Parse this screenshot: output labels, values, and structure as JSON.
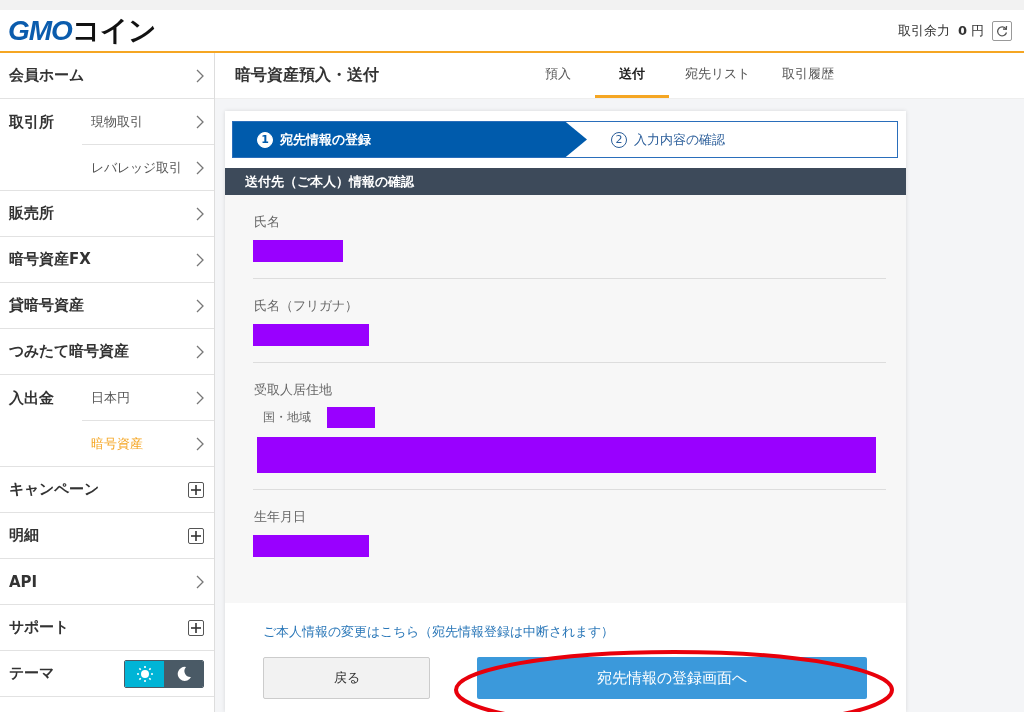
{
  "header": {
    "logo": {
      "brand": "GMO",
      "name": "コイン"
    },
    "balance_label": "取引余力",
    "balance_value": "0",
    "balance_unit": "円"
  },
  "sidebar": {
    "items": [
      {
        "kind": "link",
        "label": "会員ホーム"
      },
      {
        "kind": "group",
        "label": "取引所",
        "children": [
          {
            "label": "現物取引",
            "selected": false
          },
          {
            "label": "レバレッジ取引",
            "selected": false
          }
        ]
      },
      {
        "kind": "link",
        "label": "販売所"
      },
      {
        "kind": "link",
        "label": "暗号資産FX"
      },
      {
        "kind": "link",
        "label": "貸暗号資産"
      },
      {
        "kind": "link",
        "label": "つみたて暗号資産"
      },
      {
        "kind": "group",
        "label": "入出金",
        "children": [
          {
            "label": "日本円",
            "selected": false
          },
          {
            "label": "暗号資産",
            "selected": true
          }
        ]
      },
      {
        "kind": "expand",
        "label": "キャンペーン",
        "expanded": false
      },
      {
        "kind": "expand",
        "label": "明細",
        "expanded": false
      },
      {
        "kind": "link",
        "label": "API"
      },
      {
        "kind": "expand",
        "label": "サポート",
        "expanded": false
      },
      {
        "kind": "theme",
        "label": "テーマ",
        "options": [
          {
            "kind": "sun",
            "selected": true
          },
          {
            "kind": "moon",
            "selected": false
          }
        ]
      }
    ]
  },
  "page": {
    "title": "暗号資産預入・送付",
    "tabs": [
      {
        "label": "預入",
        "selected": false
      },
      {
        "label": "送付",
        "selected": true
      },
      {
        "label": "宛先リスト",
        "selected": false
      },
      {
        "label": "取引履歴",
        "selected": false
      }
    ]
  },
  "steps": [
    {
      "number": "1",
      "label": "宛先情報の登録",
      "selected": true
    },
    {
      "number": "2",
      "label": "入力内容の確認",
      "selected": false
    }
  ],
  "section": {
    "title": "送付先（ご本人）情報の確認",
    "fields": [
      {
        "kind": "simple",
        "label": "氏名"
      },
      {
        "kind": "simple",
        "label": "氏名（フリガナ）"
      },
      {
        "kind": "address",
        "label": "受取人居住地",
        "sub_label": "国・地域"
      },
      {
        "kind": "simple",
        "label": "生年月日"
      }
    ]
  },
  "footer": {
    "link": "ご本人情報の変更はこちら（宛先情報登録は中断されます）",
    "back_button": "戻る",
    "next_button": "宛先情報の登録画面へ"
  }
}
